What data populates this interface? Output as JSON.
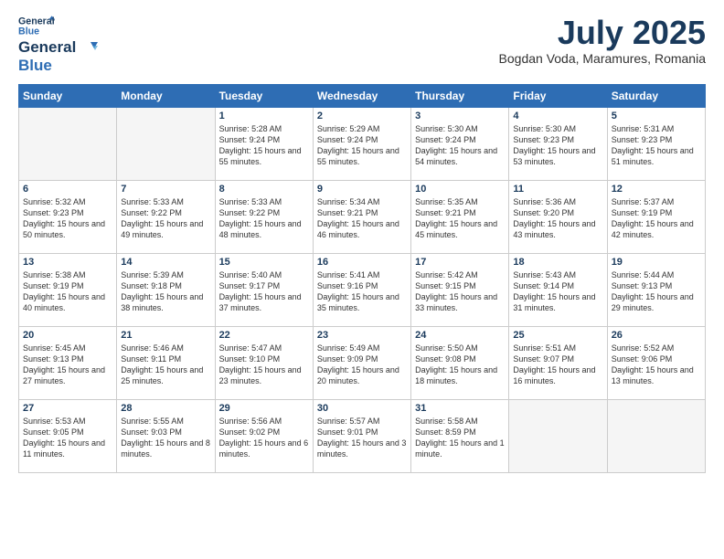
{
  "header": {
    "logo_line1": "General",
    "logo_line2": "Blue",
    "month": "July 2025",
    "location": "Bogdan Voda, Maramures, Romania"
  },
  "weekdays": [
    "Sunday",
    "Monday",
    "Tuesday",
    "Wednesday",
    "Thursday",
    "Friday",
    "Saturday"
  ],
  "weeks": [
    [
      {
        "day": "",
        "info": ""
      },
      {
        "day": "",
        "info": ""
      },
      {
        "day": "1",
        "info": "Sunrise: 5:28 AM\nSunset: 9:24 PM\nDaylight: 15 hours and 55 minutes."
      },
      {
        "day": "2",
        "info": "Sunrise: 5:29 AM\nSunset: 9:24 PM\nDaylight: 15 hours and 55 minutes."
      },
      {
        "day": "3",
        "info": "Sunrise: 5:30 AM\nSunset: 9:24 PM\nDaylight: 15 hours and 54 minutes."
      },
      {
        "day": "4",
        "info": "Sunrise: 5:30 AM\nSunset: 9:23 PM\nDaylight: 15 hours and 53 minutes."
      },
      {
        "day": "5",
        "info": "Sunrise: 5:31 AM\nSunset: 9:23 PM\nDaylight: 15 hours and 51 minutes."
      }
    ],
    [
      {
        "day": "6",
        "info": "Sunrise: 5:32 AM\nSunset: 9:23 PM\nDaylight: 15 hours and 50 minutes."
      },
      {
        "day": "7",
        "info": "Sunrise: 5:33 AM\nSunset: 9:22 PM\nDaylight: 15 hours and 49 minutes."
      },
      {
        "day": "8",
        "info": "Sunrise: 5:33 AM\nSunset: 9:22 PM\nDaylight: 15 hours and 48 minutes."
      },
      {
        "day": "9",
        "info": "Sunrise: 5:34 AM\nSunset: 9:21 PM\nDaylight: 15 hours and 46 minutes."
      },
      {
        "day": "10",
        "info": "Sunrise: 5:35 AM\nSunset: 9:21 PM\nDaylight: 15 hours and 45 minutes."
      },
      {
        "day": "11",
        "info": "Sunrise: 5:36 AM\nSunset: 9:20 PM\nDaylight: 15 hours and 43 minutes."
      },
      {
        "day": "12",
        "info": "Sunrise: 5:37 AM\nSunset: 9:19 PM\nDaylight: 15 hours and 42 minutes."
      }
    ],
    [
      {
        "day": "13",
        "info": "Sunrise: 5:38 AM\nSunset: 9:19 PM\nDaylight: 15 hours and 40 minutes."
      },
      {
        "day": "14",
        "info": "Sunrise: 5:39 AM\nSunset: 9:18 PM\nDaylight: 15 hours and 38 minutes."
      },
      {
        "day": "15",
        "info": "Sunrise: 5:40 AM\nSunset: 9:17 PM\nDaylight: 15 hours and 37 minutes."
      },
      {
        "day": "16",
        "info": "Sunrise: 5:41 AM\nSunset: 9:16 PM\nDaylight: 15 hours and 35 minutes."
      },
      {
        "day": "17",
        "info": "Sunrise: 5:42 AM\nSunset: 9:15 PM\nDaylight: 15 hours and 33 minutes."
      },
      {
        "day": "18",
        "info": "Sunrise: 5:43 AM\nSunset: 9:14 PM\nDaylight: 15 hours and 31 minutes."
      },
      {
        "day": "19",
        "info": "Sunrise: 5:44 AM\nSunset: 9:13 PM\nDaylight: 15 hours and 29 minutes."
      }
    ],
    [
      {
        "day": "20",
        "info": "Sunrise: 5:45 AM\nSunset: 9:13 PM\nDaylight: 15 hours and 27 minutes."
      },
      {
        "day": "21",
        "info": "Sunrise: 5:46 AM\nSunset: 9:11 PM\nDaylight: 15 hours and 25 minutes."
      },
      {
        "day": "22",
        "info": "Sunrise: 5:47 AM\nSunset: 9:10 PM\nDaylight: 15 hours and 23 minutes."
      },
      {
        "day": "23",
        "info": "Sunrise: 5:49 AM\nSunset: 9:09 PM\nDaylight: 15 hours and 20 minutes."
      },
      {
        "day": "24",
        "info": "Sunrise: 5:50 AM\nSunset: 9:08 PM\nDaylight: 15 hours and 18 minutes."
      },
      {
        "day": "25",
        "info": "Sunrise: 5:51 AM\nSunset: 9:07 PM\nDaylight: 15 hours and 16 minutes."
      },
      {
        "day": "26",
        "info": "Sunrise: 5:52 AM\nSunset: 9:06 PM\nDaylight: 15 hours and 13 minutes."
      }
    ],
    [
      {
        "day": "27",
        "info": "Sunrise: 5:53 AM\nSunset: 9:05 PM\nDaylight: 15 hours and 11 minutes."
      },
      {
        "day": "28",
        "info": "Sunrise: 5:55 AM\nSunset: 9:03 PM\nDaylight: 15 hours and 8 minutes."
      },
      {
        "day": "29",
        "info": "Sunrise: 5:56 AM\nSunset: 9:02 PM\nDaylight: 15 hours and 6 minutes."
      },
      {
        "day": "30",
        "info": "Sunrise: 5:57 AM\nSunset: 9:01 PM\nDaylight: 15 hours and 3 minutes."
      },
      {
        "day": "31",
        "info": "Sunrise: 5:58 AM\nSunset: 8:59 PM\nDaylight: 15 hours and 1 minute."
      },
      {
        "day": "",
        "info": ""
      },
      {
        "day": "",
        "info": ""
      }
    ]
  ]
}
